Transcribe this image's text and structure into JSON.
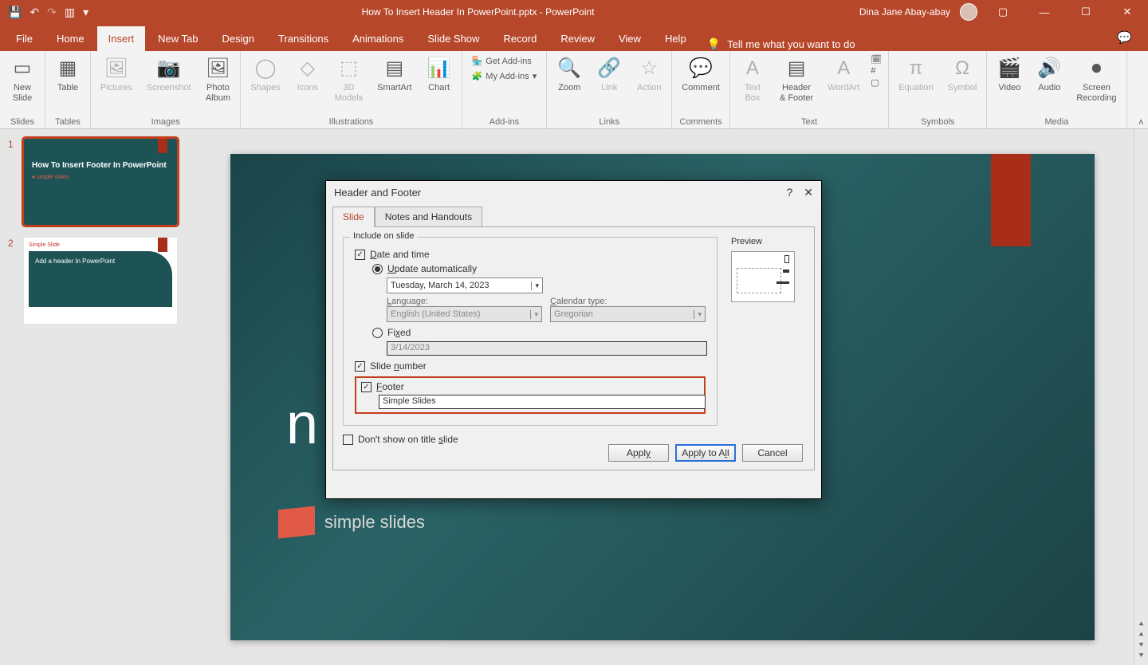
{
  "titlebar": {
    "documentTitle": "How To Insert Header In PowerPoint.pptx  -  PowerPoint",
    "userName": "Dina Jane Abay-abay"
  },
  "tabs": [
    "File",
    "Home",
    "Insert",
    "New Tab",
    "Design",
    "Transitions",
    "Animations",
    "Slide Show",
    "Record",
    "Review",
    "View",
    "Help"
  ],
  "activeTab": "Insert",
  "tellMe": "Tell me what you want to do",
  "ribbon": {
    "groups": {
      "slides": {
        "label": "Slides",
        "newSlide": "New\nSlide"
      },
      "tables": {
        "label": "Tables",
        "table": "Table"
      },
      "images": {
        "label": "Images",
        "pictures": "Pictures",
        "screenshot": "Screenshot",
        "photoAlbum": "Photo\nAlbum"
      },
      "illustrations": {
        "label": "Illustrations",
        "shapes": "Shapes",
        "icons": "Icons",
        "models": "3D\nModels",
        "smartart": "SmartArt",
        "chart": "Chart"
      },
      "addins": {
        "label": "Add-ins",
        "getAddins": "Get Add-ins",
        "myAddins": "My Add-ins"
      },
      "links": {
        "label": "Links",
        "zoom": "Zoom",
        "link": "Link",
        "action": "Action"
      },
      "comments": {
        "label": "Comments",
        "comment": "Comment"
      },
      "text": {
        "label": "Text",
        "textBox": "Text\nBox",
        "headerFooter": "Header\n& Footer",
        "wordart": "WordArt"
      },
      "symbols": {
        "label": "Symbols",
        "equation": "Equation",
        "symbol": "Symbol"
      },
      "media": {
        "label": "Media",
        "video": "Video",
        "audio": "Audio",
        "screenRec": "Screen\nRecording"
      }
    }
  },
  "thumbs": {
    "s1": {
      "num": "1",
      "title": "How To Insert Footer In PowerPoint",
      "brand": "simple slides"
    },
    "s2": {
      "num": "2",
      "tag": "Simple Slide",
      "title": "Add a header In PowerPoint"
    }
  },
  "slide": {
    "titleLine1": "n",
    "brand": "simple slides"
  },
  "dialog": {
    "title": "Header and Footer",
    "tabSlide": "Slide",
    "tabNotes": "Notes and Handouts",
    "includeOnSlide": "Include on slide",
    "dateTime": "Date and time",
    "updateAuto": "Update automatically",
    "dateValue": "Tuesday, March 14, 2023",
    "languageLabel": "Language:",
    "languageValue": "English (United States)",
    "calendarLabel": "Calendar type:",
    "calendarValue": "Gregorian",
    "fixed": "Fixed",
    "fixedValue": "3/14/2023",
    "slideNumber": "Slide number",
    "footer": "Footer",
    "footerValue": "Simple Slides",
    "dontShow": "Don't show on title slide",
    "preview": "Preview",
    "apply": "Apply",
    "applyAll": "Apply to All",
    "cancel": "Cancel"
  }
}
